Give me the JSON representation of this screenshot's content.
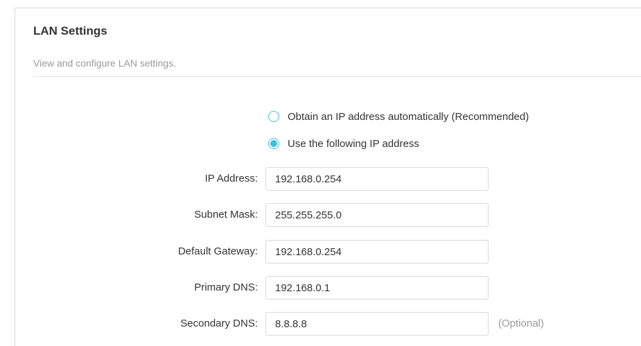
{
  "section": {
    "title": "LAN Settings",
    "description": "View and configure LAN settings."
  },
  "ip_mode": {
    "options": [
      {
        "label": "Obtain an IP address automatically (Recommended)",
        "selected": false
      },
      {
        "label": "Use the following IP address",
        "selected": true
      }
    ]
  },
  "fields": {
    "ip_address": {
      "label": "IP Address:",
      "value": "192.168.0.254"
    },
    "subnet_mask": {
      "label": "Subnet Mask:",
      "value": "255.255.255.0"
    },
    "default_gateway": {
      "label": "Default Gateway:",
      "value": "192.168.0.254"
    },
    "primary_dns": {
      "label": "Primary DNS:",
      "value": "192.168.0.1"
    },
    "secondary_dns": {
      "label": "Secondary DNS:",
      "value": "8.8.8.8",
      "hint": "(Optional)"
    }
  },
  "colors": {
    "accent": "#3fc0d2",
    "text": "#333333",
    "muted": "#999999",
    "border": "#d9d9d9"
  }
}
